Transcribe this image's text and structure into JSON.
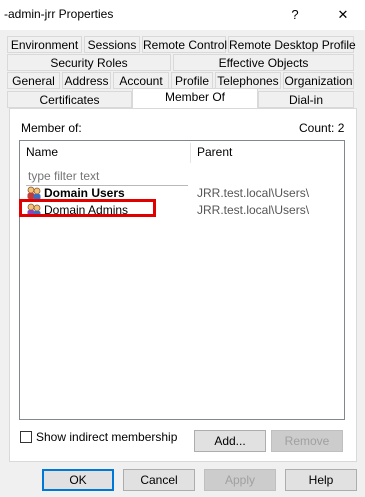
{
  "window": {
    "title": "-admin-jrr Properties",
    "help_glyph": "?",
    "close_glyph": "✕"
  },
  "tabs": {
    "row1": [
      "Environment",
      "Sessions",
      "Remote Control",
      "Remote Desktop Profile"
    ],
    "row2": [
      "Security Roles",
      "Effective Objects"
    ],
    "row3": [
      "General",
      "Address",
      "Account",
      "Profile",
      "Telephones",
      "Organization"
    ],
    "row4": [
      "Certificates",
      "Member Of",
      "Dial-in"
    ],
    "active": "Member Of"
  },
  "member_of": {
    "label": "Member of:",
    "count_label": "Count: 2",
    "columns": {
      "name": "Name",
      "parent": "Parent"
    },
    "filter_placeholder": "type filter text",
    "rows": [
      {
        "name": "Domain Users",
        "parent": "JRR.test.local\\Users\\",
        "icon": "group-icon"
      },
      {
        "name": "Domain Admins",
        "parent": "JRR.test.local\\Users\\",
        "icon": "group-icon"
      }
    ]
  },
  "options": {
    "show_indirect_label": "Show indirect membership",
    "show_indirect_checked": false
  },
  "actions": {
    "add_label": "Add...",
    "remove_label": "Remove"
  },
  "footer": {
    "ok_label": "OK",
    "cancel_label": "Cancel",
    "apply_label": "Apply",
    "help_label": "Help"
  },
  "colors": {
    "highlight": "#e00000",
    "accent": "#0078d7"
  }
}
